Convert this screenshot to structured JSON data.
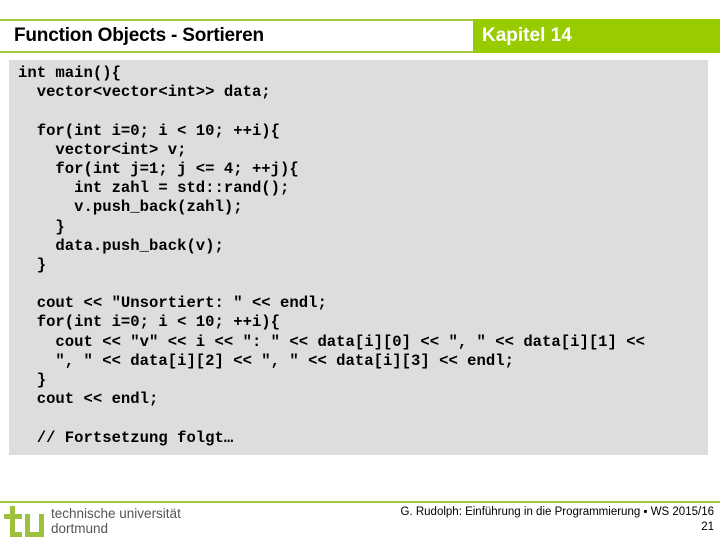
{
  "header": {
    "title": "Function Objects - Sortieren",
    "chapter": "Kapitel 14",
    "accent_color": "#99cc00"
  },
  "code": {
    "lines": [
      "int main(){",
      "  vector<vector<int>> data;",
      "",
      "  for(int i=0; i < 10; ++i){",
      "    vector<int> v;",
      "    for(int j=1; j <= 4; ++j){",
      "      int zahl = std::rand();",
      "      v.push_back(zahl);",
      "    }",
      "    data.push_back(v);",
      "  }",
      "",
      "  cout << \"Unsortiert: \" << endl;",
      "  for(int i=0; i < 10; ++i){",
      "    cout << \"v\" << i << \": \" << data[i][0] << \", \" << data[i][1] <<",
      "    \", \" << data[i][2] << \", \" << data[i][3] << endl;",
      "  }",
      "  cout << endl;",
      "",
      "  // Fortsetzung folgt…"
    ]
  },
  "footer": {
    "university_line1": "technische universität",
    "university_line2": "dortmund",
    "credit": "G. Rudolph: Einführung in die Programmierung ▪ WS 2015/16",
    "page_number": "21"
  }
}
